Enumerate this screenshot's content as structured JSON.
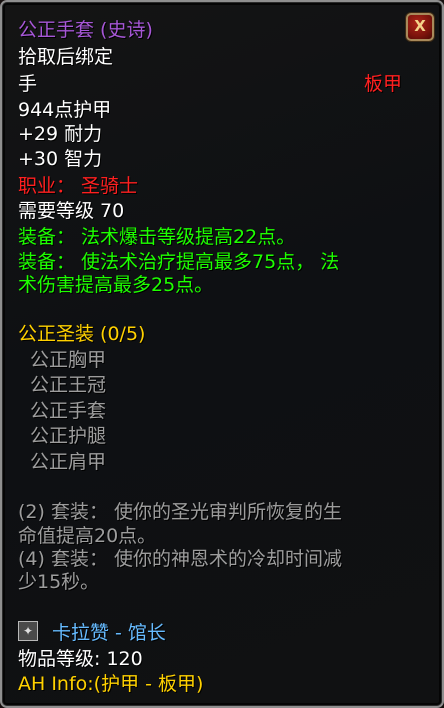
{
  "item": {
    "name": "公正手套 (史诗)",
    "bind": "拾取后绑定",
    "slot": "手",
    "armor_type": "板甲",
    "armor": "944点护甲",
    "stats": [
      "+29 耐力",
      "+30 智力"
    ],
    "class_req": "职业： 圣骑士",
    "level_req": "需要等级 70",
    "equip": [
      "装备： 法术爆击等级提高22点。",
      "装备： 使法术治疗提高最多75点， 法",
      "术伤害提高最多25点。"
    ]
  },
  "set": {
    "title": "公正圣装 (0/5)",
    "pieces": [
      "公正胸甲",
      "公正王冠",
      "公正手套",
      "公正护腿",
      "公正肩甲"
    ],
    "bonuses": [
      "(2) 套装： 使你的圣光审判所恢复的生",
      "命值提高20点。",
      "(4) 套装： 使你的神恩术的冷却时间减",
      "少15秒。"
    ]
  },
  "source": {
    "icon": "curator-boss-icon",
    "text": "卡拉赞 - 馆长"
  },
  "item_level": "物品等级: 120",
  "ah_info": "AH Info:(护甲 - 板甲)",
  "close": {
    "icon": "close-x-icon",
    "label": "X"
  },
  "colors": {
    "epic": "#a657d6",
    "green": "#1eff00",
    "red": "#ff2020",
    "gold": "#ffd100",
    "grey": "#9d9d9d",
    "blue": "#66bbff"
  }
}
